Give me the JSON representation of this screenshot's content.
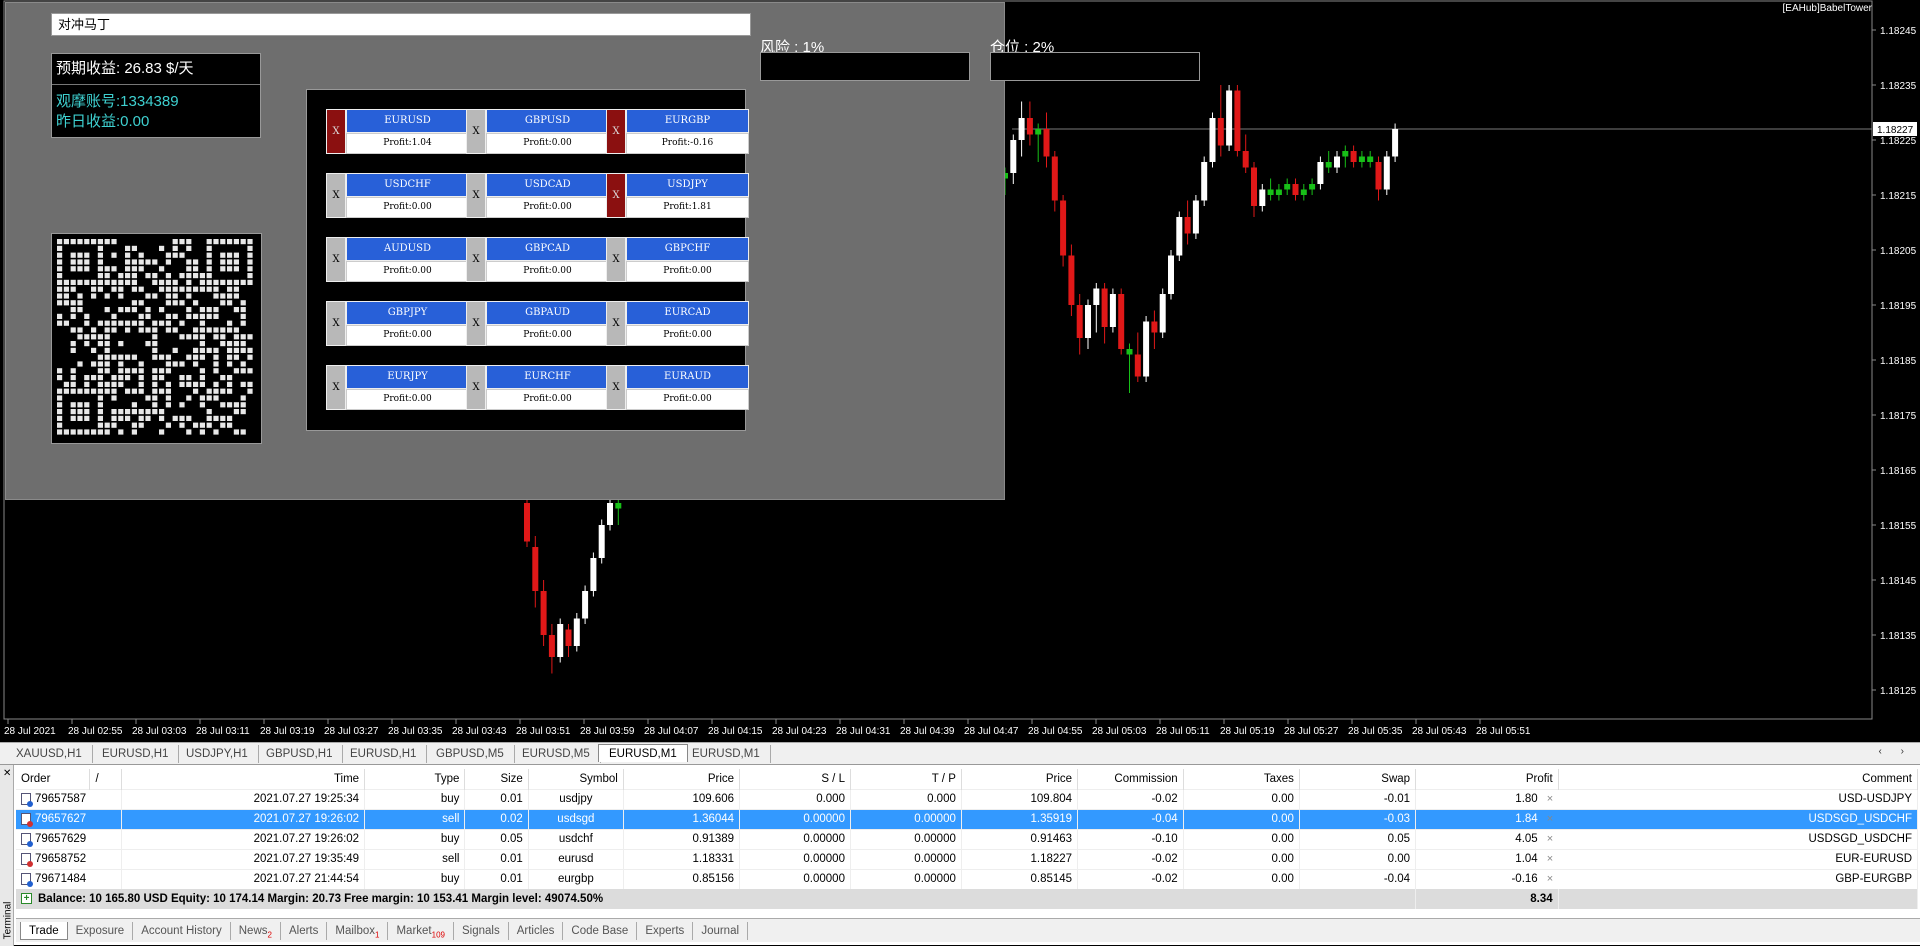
{
  "chart": {
    "ea_tag": "[EAHub]BabelTower",
    "current_price": "1.18227",
    "price_axis": [
      "1.18245",
      "1.18235",
      "1.18225",
      "1.18215",
      "1.18205",
      "1.18195",
      "1.18185",
      "1.18175",
      "1.18165",
      "1.18155",
      "1.18145",
      "1.18135",
      "1.18125"
    ],
    "time_axis": [
      "28 Jul 2021",
      "28 Jul 02:55",
      "28 Jul 03:03",
      "28 Jul 03:11",
      "28 Jul 03:19",
      "28 Jul 03:27",
      "28 Jul 03:35",
      "28 Jul 03:43",
      "28 Jul 03:51",
      "28 Jul 03:59",
      "28 Jul 04:07",
      "28 Jul 04:15",
      "28 Jul 04:23",
      "28 Jul 04:31",
      "28 Jul 04:39",
      "28 Jul 04:47",
      "28 Jul 04:55",
      "28 Jul 05:03",
      "28 Jul 05:11",
      "28 Jul 05:19",
      "28 Jul 05:27",
      "28 Jul 05:35",
      "28 Jul 05:43",
      "28 Jul 05:51"
    ],
    "candles": [
      {
        "o": 1.18159,
        "h": 1.18162,
        "l": 1.18151,
        "c": 1.18152,
        "bull": false
      },
      {
        "o": 1.18151,
        "h": 1.18153,
        "l": 1.1814,
        "c": 1.18143,
        "bull": false
      },
      {
        "o": 1.18143,
        "h": 1.18145,
        "l": 1.18133,
        "c": 1.18135,
        "bull": false
      },
      {
        "o": 1.18135,
        "h": 1.18137,
        "l": 1.18128,
        "c": 1.18131,
        "bull": false
      },
      {
        "o": 1.18131,
        "h": 1.18138,
        "l": 1.1813,
        "c": 1.18137,
        "bull": true
      },
      {
        "o": 1.18136,
        "h": 1.18137,
        "l": 1.18131,
        "c": 1.18133,
        "bull": false
      },
      {
        "o": 1.18133,
        "h": 1.18139,
        "l": 1.18132,
        "c": 1.18138,
        "bull": true
      },
      {
        "o": 1.18138,
        "h": 1.18144,
        "l": 1.18137,
        "c": 1.18143,
        "bull": true
      },
      {
        "o": 1.18143,
        "h": 1.1815,
        "l": 1.18142,
        "c": 1.18149,
        "bull": true
      },
      {
        "o": 1.18149,
        "h": 1.18156,
        "l": 1.18148,
        "c": 1.18155,
        "bull": true
      },
      {
        "o": 1.18155,
        "h": 1.1816,
        "l": 1.18154,
        "c": 1.18159,
        "bull": true
      },
      {
        "o": 1.18158,
        "h": 1.1816,
        "l": 1.18155,
        "c": 1.18159,
        "bull": true
      }
    ],
    "candles2": [
      {
        "o": 1.18218,
        "h": 1.1822,
        "l": 1.18215,
        "c": 1.18219,
        "bull": true
      },
      {
        "o": 1.18219,
        "h": 1.18226,
        "l": 1.18217,
        "c": 1.18225,
        "bull": true
      },
      {
        "o": 1.18225,
        "h": 1.18232,
        "l": 1.18222,
        "c": 1.18229,
        "bull": true
      },
      {
        "o": 1.18229,
        "h": 1.18232,
        "l": 1.18224,
        "c": 1.18226,
        "bull": false
      },
      {
        "o": 1.18226,
        "h": 1.18228,
        "l": 1.18221,
        "c": 1.18227,
        "bull": true
      },
      {
        "o": 1.18227,
        "h": 1.1823,
        "l": 1.1822,
        "c": 1.18222,
        "bull": false
      },
      {
        "o": 1.18222,
        "h": 1.18223,
        "l": 1.18212,
        "c": 1.18214,
        "bull": false
      },
      {
        "o": 1.18214,
        "h": 1.18215,
        "l": 1.18202,
        "c": 1.18204,
        "bull": false
      },
      {
        "o": 1.18204,
        "h": 1.18206,
        "l": 1.18193,
        "c": 1.18195,
        "bull": false
      },
      {
        "o": 1.18195,
        "h": 1.18197,
        "l": 1.18186,
        "c": 1.18189,
        "bull": false
      },
      {
        "o": 1.18189,
        "h": 1.18196,
        "l": 1.18187,
        "c": 1.18195,
        "bull": true
      },
      {
        "o": 1.18195,
        "h": 1.18199,
        "l": 1.1819,
        "c": 1.18198,
        "bull": true
      },
      {
        "o": 1.18198,
        "h": 1.18199,
        "l": 1.18188,
        "c": 1.18191,
        "bull": false
      },
      {
        "o": 1.18191,
        "h": 1.18198,
        "l": 1.1819,
        "c": 1.18197,
        "bull": true
      },
      {
        "o": 1.18197,
        "h": 1.18198,
        "l": 1.18186,
        "c": 1.18187,
        "bull": false
      },
      {
        "o": 1.18187,
        "h": 1.18188,
        "l": 1.18179,
        "c": 1.18186,
        "bull": true
      },
      {
        "o": 1.18186,
        "h": 1.1819,
        "l": 1.18181,
        "c": 1.18182,
        "bull": false
      },
      {
        "o": 1.18182,
        "h": 1.18193,
        "l": 1.18181,
        "c": 1.18192,
        "bull": true
      },
      {
        "o": 1.18192,
        "h": 1.18194,
        "l": 1.18187,
        "c": 1.1819,
        "bull": false
      },
      {
        "o": 1.1819,
        "h": 1.18198,
        "l": 1.18189,
        "c": 1.18197,
        "bull": true
      },
      {
        "o": 1.18197,
        "h": 1.18205,
        "l": 1.18196,
        "c": 1.18204,
        "bull": true
      },
      {
        "o": 1.18204,
        "h": 1.18212,
        "l": 1.18203,
        "c": 1.18211,
        "bull": true
      },
      {
        "o": 1.18211,
        "h": 1.18214,
        "l": 1.18206,
        "c": 1.18208,
        "bull": false
      },
      {
        "o": 1.18208,
        "h": 1.18215,
        "l": 1.18207,
        "c": 1.18214,
        "bull": true
      },
      {
        "o": 1.18214,
        "h": 1.18222,
        "l": 1.18213,
        "c": 1.18221,
        "bull": true
      },
      {
        "o": 1.18221,
        "h": 1.1823,
        "l": 1.1822,
        "c": 1.18229,
        "bull": true
      },
      {
        "o": 1.18229,
        "h": 1.18235,
        "l": 1.18222,
        "c": 1.18224,
        "bull": false
      },
      {
        "o": 1.18224,
        "h": 1.18235,
        "l": 1.18223,
        "c": 1.18234,
        "bull": true
      },
      {
        "o": 1.18234,
        "h": 1.18235,
        "l": 1.18222,
        "c": 1.18223,
        "bull": false
      },
      {
        "o": 1.18223,
        "h": 1.18226,
        "l": 1.18219,
        "c": 1.1822,
        "bull": false
      },
      {
        "o": 1.1822,
        "h": 1.18221,
        "l": 1.18211,
        "c": 1.18213,
        "bull": false
      },
      {
        "o": 1.18213,
        "h": 1.18217,
        "l": 1.18212,
        "c": 1.18216,
        "bull": true
      },
      {
        "o": 1.18216,
        "h": 1.18218,
        "l": 1.18214,
        "c": 1.18215,
        "bull": false
      },
      {
        "o": 1.18215,
        "h": 1.18217,
        "l": 1.18214,
        "c": 1.18216,
        "bull": true
      },
      {
        "o": 1.18216,
        "h": 1.18218,
        "l": 1.18215,
        "c": 1.18217,
        "bull": true
      },
      {
        "o": 1.18217,
        "h": 1.18218,
        "l": 1.18214,
        "c": 1.18215,
        "bull": false
      },
      {
        "o": 1.18215,
        "h": 1.18217,
        "l": 1.18214,
        "c": 1.18216,
        "bull": true
      },
      {
        "o": 1.18216,
        "h": 1.18218,
        "l": 1.18215,
        "c": 1.18217,
        "bull": true
      },
      {
        "o": 1.18217,
        "h": 1.18222,
        "l": 1.18216,
        "c": 1.18221,
        "bull": true
      },
      {
        "o": 1.18221,
        "h": 1.18223,
        "l": 1.18219,
        "c": 1.1822,
        "bull": false
      },
      {
        "o": 1.1822,
        "h": 1.18223,
        "l": 1.18219,
        "c": 1.18222,
        "bull": true
      },
      {
        "o": 1.18222,
        "h": 1.18224,
        "l": 1.1822,
        "c": 1.18223,
        "bull": true
      },
      {
        "o": 1.18223,
        "h": 1.18224,
        "l": 1.1822,
        "c": 1.18221,
        "bull": false
      },
      {
        "o": 1.18221,
        "h": 1.18223,
        "l": 1.1822,
        "c": 1.18222,
        "bull": true
      },
      {
        "o": 1.18222,
        "h": 1.18223,
        "l": 1.1822,
        "c": 1.18221,
        "bull": false
      },
      {
        "o": 1.18221,
        "h": 1.18222,
        "l": 1.18214,
        "c": 1.18216,
        "bull": false
      },
      {
        "o": 1.18216,
        "h": 1.18223,
        "l": 1.18215,
        "c": 1.18222,
        "bull": true
      },
      {
        "o": 1.18222,
        "h": 1.18228,
        "l": 1.18221,
        "c": 1.18227,
        "bull": true
      }
    ]
  },
  "panel": {
    "title": "对冲马丁",
    "expected_income": "预期收益: 26.83 $/天",
    "account": "观摩账号:1334389",
    "yesterday": "昨日收益:0.00",
    "risk_label": "风险 : 1%",
    "position_label": "仓位 : 2%",
    "pairs": [
      {
        "x": "X",
        "name": "EURUSD",
        "profit": "Profit:1.04",
        "active": true
      },
      {
        "x": "X",
        "name": "GBPUSD",
        "profit": "Profit:0.00",
        "active": false
      },
      {
        "x": "X",
        "name": "EURGBP",
        "profit": "Profit:-0.16",
        "active": true
      },
      {
        "x": "X",
        "name": "USDCHF",
        "profit": "Profit:0.00",
        "active": false
      },
      {
        "x": "X",
        "name": "USDCAD",
        "profit": "Profit:0.00",
        "active": false
      },
      {
        "x": "X",
        "name": "USDJPY",
        "profit": "Profit:1.81",
        "active": true
      },
      {
        "x": "X",
        "name": "AUDUSD",
        "profit": "Profit:0.00",
        "active": false
      },
      {
        "x": "X",
        "name": "GBPCAD",
        "profit": "Profit:0.00",
        "active": false
      },
      {
        "x": "X",
        "name": "GBPCHF",
        "profit": "Profit:0.00",
        "active": false
      },
      {
        "x": "X",
        "name": "GBPJPY",
        "profit": "Profit:0.00",
        "active": false
      },
      {
        "x": "X",
        "name": "GBPAUD",
        "profit": "Profit:0.00",
        "active": false
      },
      {
        "x": "X",
        "name": "EURCAD",
        "profit": "Profit:0.00",
        "active": false
      },
      {
        "x": "X",
        "name": "EURJPY",
        "profit": "Profit:0.00",
        "active": false
      },
      {
        "x": "X",
        "name": "EURCHF",
        "profit": "Profit:0.00",
        "active": false
      },
      {
        "x": "X",
        "name": "EURAUD",
        "profit": "Profit:0.00",
        "active": false
      }
    ]
  },
  "chart_tabs": [
    "XAUUSD,H1",
    "EURUSD,H1",
    "USDJPY,H1",
    "GBPUSD,H1",
    "EURUSD,H1",
    "GBPUSD,M5",
    "EURUSD,M5",
    "EURUSD,M1",
    "EURUSD,M1"
  ],
  "chart_tabs_active": 7,
  "terminal": {
    "close_glyph": "✕",
    "side_label": "Terminal",
    "columns": [
      "Order",
      "/",
      "Time",
      "Type",
      "Size",
      "Symbol",
      "Price",
      "S / L",
      "T / P",
      "Price",
      "Commission",
      "Taxes",
      "Swap",
      "Profit",
      "Comment"
    ],
    "rows": [
      {
        "order": "79657587",
        "time": "2021.07.27 19:25:34",
        "type": "buy",
        "size": "0.01",
        "symbol": "usdjpy",
        "price": "109.606",
        "sl": "0.000",
        "tp": "0.000",
        "price2": "109.804",
        "commission": "-0.02",
        "taxes": "0.00",
        "swap": "-0.01",
        "profit": "1.80",
        "comment": "USD-USDJPY",
        "selected": false
      },
      {
        "order": "79657627",
        "time": "2021.07.27 19:26:02",
        "type": "sell",
        "size": "0.02",
        "symbol": "usdsgd",
        "price": "1.36044",
        "sl": "0.00000",
        "tp": "0.00000",
        "price2": "1.35919",
        "commission": "-0.04",
        "taxes": "0.00",
        "swap": "-0.03",
        "profit": "1.84",
        "comment": "USDSGD_USDCHF",
        "selected": true
      },
      {
        "order": "79657629",
        "time": "2021.07.27 19:26:02",
        "type": "buy",
        "size": "0.05",
        "symbol": "usdchf",
        "price": "0.91389",
        "sl": "0.00000",
        "tp": "0.00000",
        "price2": "0.91463",
        "commission": "-0.10",
        "taxes": "0.00",
        "swap": "0.05",
        "profit": "4.05",
        "comment": "USDSGD_USDCHF",
        "selected": false
      },
      {
        "order": "79658752",
        "time": "2021.07.27 19:35:49",
        "type": "sell",
        "size": "0.01",
        "symbol": "eurusd",
        "price": "1.18331",
        "sl": "0.00000",
        "tp": "0.00000",
        "price2": "1.18227",
        "commission": "-0.02",
        "taxes": "0.00",
        "swap": "0.00",
        "profit": "1.04",
        "comment": "EUR-EURUSD",
        "selected": false
      },
      {
        "order": "79671484",
        "time": "2021.07.27 21:44:54",
        "type": "buy",
        "size": "0.01",
        "symbol": "eurgbp",
        "price": "0.85156",
        "sl": "0.00000",
        "tp": "0.00000",
        "price2": "0.85145",
        "commission": "-0.02",
        "taxes": "0.00",
        "swap": "-0.04",
        "profit": "-0.16",
        "comment": "GBP-EURGBP",
        "selected": false
      }
    ],
    "balance_line": "Balance: 10 165.80 USD  Equity: 10 174.14  Margin: 20.73  Free margin: 10 153.41  Margin level: 49074.50%",
    "total_profit": "8.34",
    "tabs": [
      {
        "label": "Trade",
        "badge": ""
      },
      {
        "label": "Exposure",
        "badge": ""
      },
      {
        "label": "Account History",
        "badge": ""
      },
      {
        "label": "News",
        "badge": "2"
      },
      {
        "label": "Alerts",
        "badge": ""
      },
      {
        "label": "Mailbox",
        "badge": "1"
      },
      {
        "label": "Market",
        "badge": "109"
      },
      {
        "label": "Signals",
        "badge": ""
      },
      {
        "label": "Articles",
        "badge": ""
      },
      {
        "label": "Code Base",
        "badge": ""
      },
      {
        "label": "Experts",
        "badge": ""
      },
      {
        "label": "Journal",
        "badge": ""
      }
    ]
  },
  "colors": {
    "bull": "#ffffff",
    "bear": "#e01818",
    "doji": "#18c018",
    "accent_blue": "#2860d8",
    "selected_row": "#3399ff"
  }
}
